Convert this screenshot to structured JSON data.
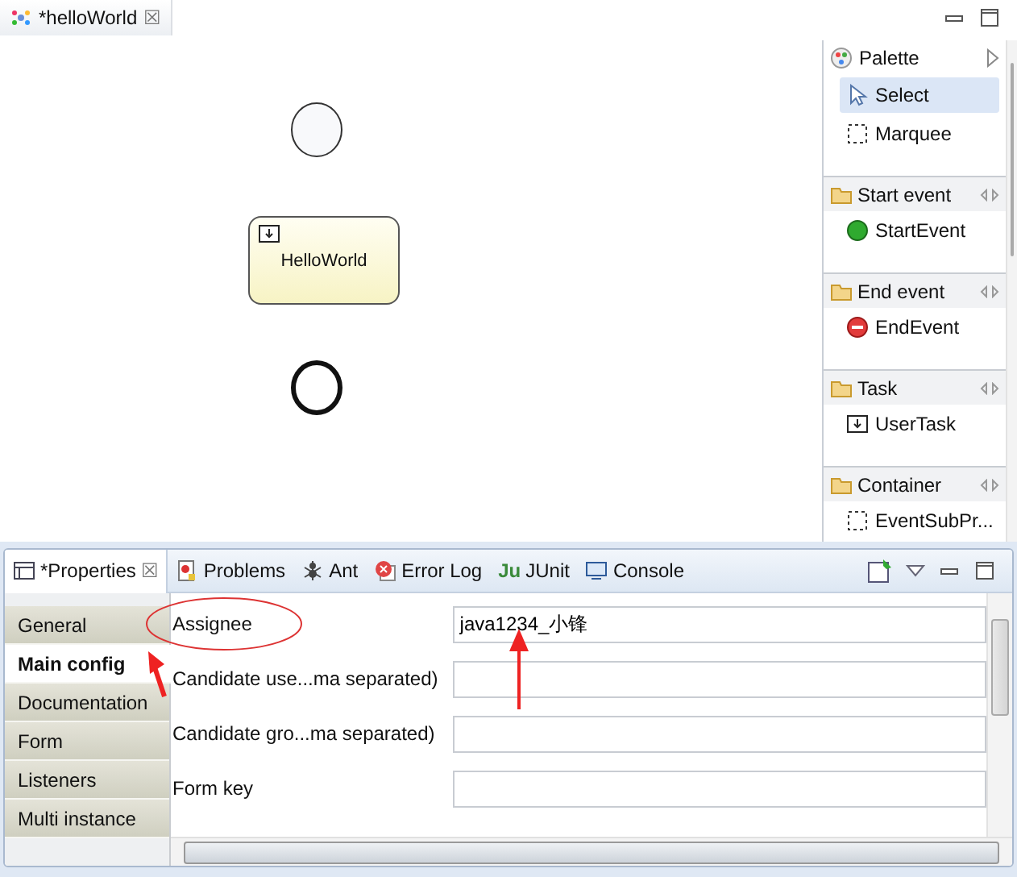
{
  "editor": {
    "tab": {
      "title": "*helloWorld",
      "close": "☒"
    }
  },
  "canvas": {
    "nodes": [
      {
        "kind": "start"
      },
      {
        "kind": "task",
        "label": "HelloWorld"
      },
      {
        "kind": "end"
      }
    ]
  },
  "palette": {
    "title": "Palette",
    "entries": [
      {
        "kind": "pointer",
        "label": "Select",
        "selected": true
      },
      {
        "kind": "marquee",
        "label": "Marquee",
        "selected": false
      },
      {
        "kind": "drawer",
        "label": "Start event"
      },
      {
        "kind": "start",
        "label": "StartEvent"
      },
      {
        "kind": "drawer",
        "label": "End event"
      },
      {
        "kind": "end",
        "label": "EndEvent"
      },
      {
        "kind": "drawer",
        "label": "Task"
      },
      {
        "kind": "task",
        "label": "UserTask"
      },
      {
        "kind": "drawer",
        "label": "Container"
      },
      {
        "kind": "subprocess",
        "label": "EventSubPr..."
      }
    ]
  },
  "views": {
    "tabs": [
      {
        "kind": "properties",
        "label": "*Properties",
        "selected": true
      },
      {
        "kind": "problems",
        "label": "Problems",
        "selected": false
      },
      {
        "kind": "ant",
        "label": "Ant",
        "selected": false
      },
      {
        "kind": "error",
        "label": "Error Log",
        "selected": false
      },
      {
        "kind": "junit",
        "badge": "Ju",
        "label": "JUnit",
        "selected": false
      },
      {
        "kind": "console",
        "label": "Console",
        "selected": false
      }
    ]
  },
  "properties": {
    "sections": [
      {
        "label": "General",
        "selected": false
      },
      {
        "label": "Main config",
        "selected": true
      },
      {
        "label": "Documentation",
        "selected": false
      },
      {
        "label": "Form",
        "selected": false
      },
      {
        "label": "Listeners",
        "selected": false
      },
      {
        "label": "Multi instance",
        "selected": false
      }
    ],
    "fields": [
      {
        "label": "Assignee",
        "value": "java1234_小锋"
      },
      {
        "label": "Candidate use...ma separated)"
      },
      {
        "label": "Candidate gro...ma separated)"
      },
      {
        "label": "Form key"
      }
    ]
  }
}
